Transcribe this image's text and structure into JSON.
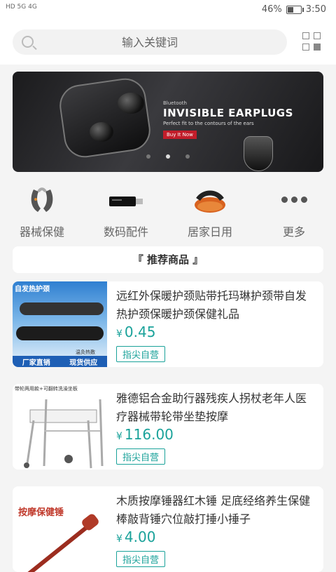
{
  "status": {
    "left": "HD 5G 4G",
    "battery": "46%",
    "battery_level": 0.46,
    "time": "3:50"
  },
  "search": {
    "placeholder": "输入关键词"
  },
  "banner": {
    "small_label": "Bluetooth",
    "title": "INVISIBLE EARPLUGS",
    "tagline": "Perfect fit to the contours of the ears",
    "button": "Buy It Now",
    "slide_count": 3,
    "active_slide": 2
  },
  "categories": [
    {
      "label": "器械保健",
      "icon": "massager-icon"
    },
    {
      "label": "数码配件",
      "icon": "usb-drive-icon"
    },
    {
      "label": "居家日用",
      "icon": "slipper-icon"
    },
    {
      "label": "更多",
      "icon": "more-icon"
    }
  ],
  "section_title": "『 推荐商品 』",
  "products": [
    {
      "title": "远红外保暖护颈贴带托玛琳护颈带自发热护颈保暖护颈保健礼品",
      "currency": "¥",
      "price": "0.45",
      "tag": "指尖自营",
      "image_text": [
        "自发热护颈",
        "温灸热敷",
        "厂家直销",
        "现货供应"
      ]
    },
    {
      "title": "雅德铝合金助行器残疾人拐杖老年人医疗器械带轮带坐垫按摩",
      "currency": "¥",
      "price": "116.00",
      "tag": "指尖自营",
      "image_text": [
        "带轮两用款+可翻转洗澡坐板"
      ]
    },
    {
      "title": "木质按摩锤器红木锤 足底经络养生保健棒敲背锤穴位敲打捶小捶子",
      "currency": "¥",
      "price": "4.00",
      "tag": "指尖自营",
      "image_text": [
        "按摩保健锤"
      ]
    }
  ],
  "colors": {
    "accent": "#1aa29a",
    "banner_button": "#c21d2a"
  }
}
